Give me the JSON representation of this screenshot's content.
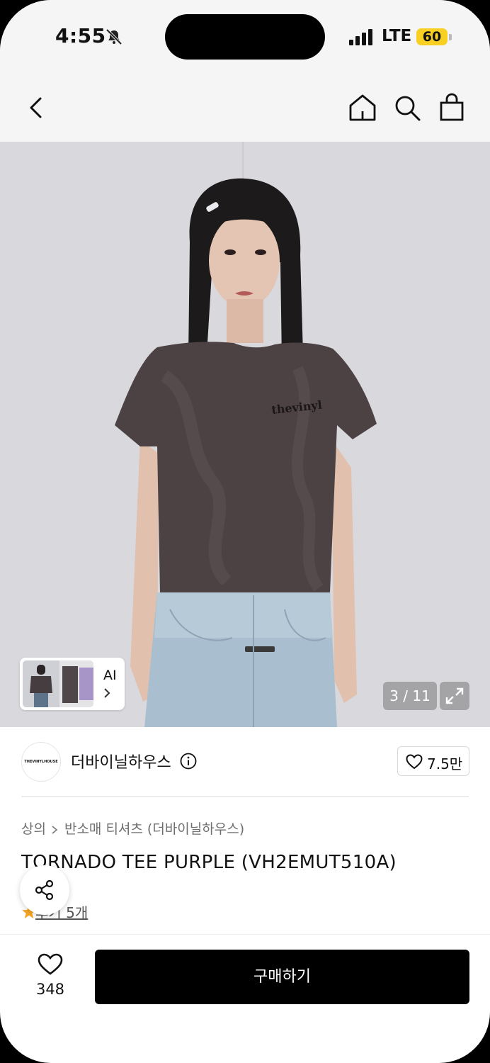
{
  "status_bar": {
    "time": "4:55",
    "network": "LTE",
    "battery": "60"
  },
  "hero": {
    "counter": "3 / 11",
    "ai_label": "AI",
    "shirt_text": "thevinyl"
  },
  "brand": {
    "name": "더바이닐하우스",
    "logo_text": "THEVINYLHOUSE",
    "likes": "7.5만"
  },
  "breadcrumb": {
    "level1": "상의",
    "level2": "반소매 티셔츠 (더바이닐하우스)"
  },
  "product": {
    "title": "TORNADO TEE PURPLE (VH2EMUT510A)"
  },
  "reviews": {
    "label": "후기 5개"
  },
  "bottom_bar": {
    "wishlist_count": "348",
    "buy_label": "구매하기"
  },
  "colors": {
    "accent_star": "#f5a623",
    "battery": "#f7d023",
    "buy_button": "#000000"
  }
}
